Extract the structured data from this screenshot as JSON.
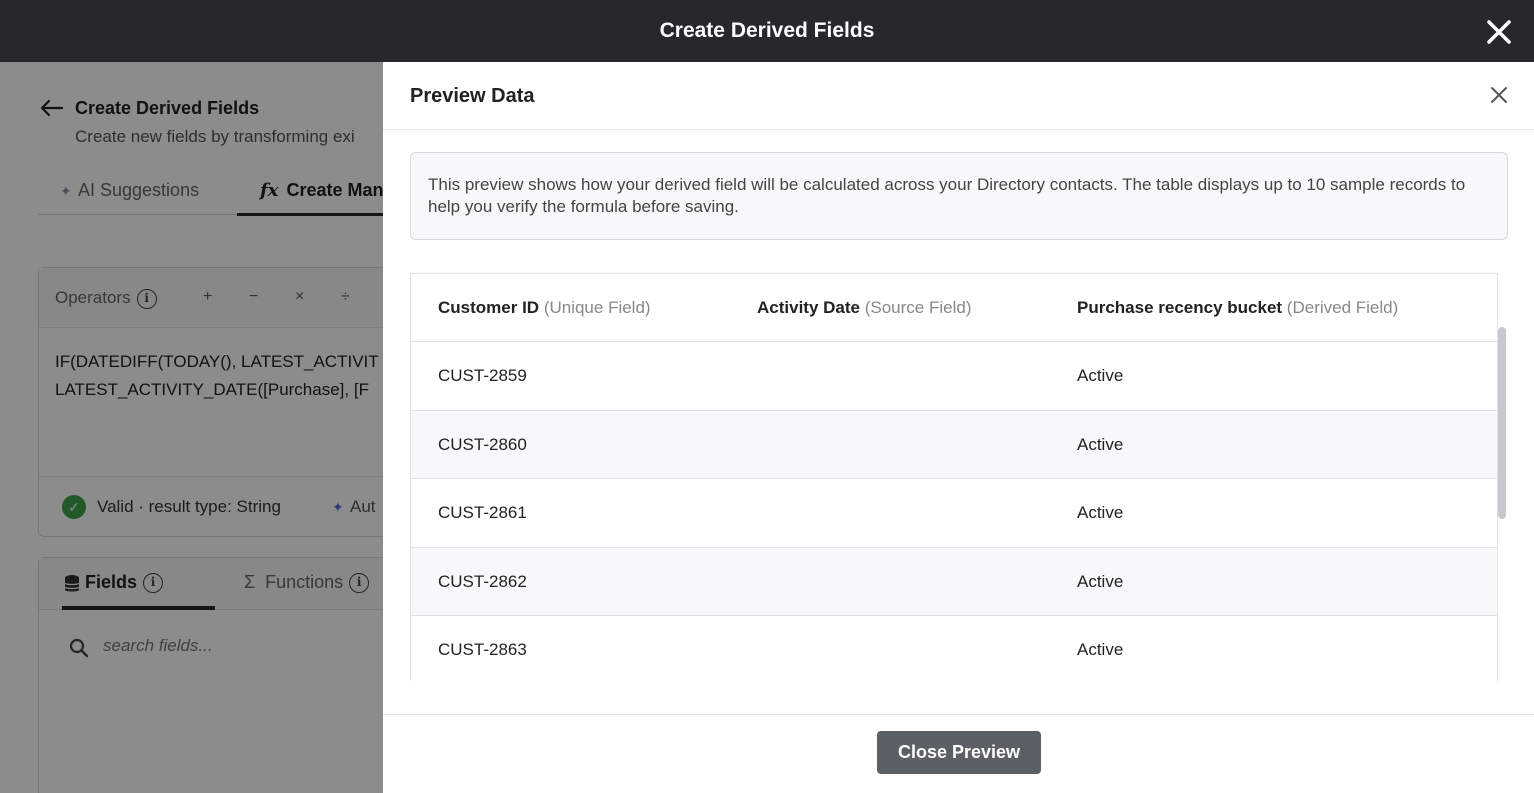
{
  "window": {
    "title": "Create Derived Fields"
  },
  "background": {
    "title": "Create Derived Fields",
    "subtitle": "Create new fields by transforming exi",
    "tabs": [
      {
        "label": "AI Suggestions"
      },
      {
        "label": "Create Man"
      }
    ],
    "operators_label": "Operators",
    "operators": [
      "+",
      "−",
      "×",
      "÷"
    ],
    "formula_lines": [
      "IF(DATEDIFF(TODAY(), LATEST_ACTIVIT",
      "LATEST_ACTIVITY_DATE([Purchase], [F"
    ],
    "validation": "Valid · result type: String",
    "auto_label": "Aut",
    "field_tabs": [
      {
        "label": "Fields"
      },
      {
        "label": "Functions"
      }
    ],
    "search_placeholder": "search fields..."
  },
  "modal": {
    "title": "Preview Data",
    "info_text": "This preview shows how your derived field will be calculated across your Directory contacts. The table displays up to 10 sample records to help you verify the formula before saving.",
    "columns": [
      {
        "name": "Customer ID",
        "hint": "(Unique Field)"
      },
      {
        "name": "Activity Date",
        "hint": "(Source Field)"
      },
      {
        "name": "Purchase recency bucket",
        "hint": "(Derived Field)"
      }
    ],
    "rows": [
      {
        "customer_id": "CUST-2859",
        "activity_date": "",
        "bucket": "Active"
      },
      {
        "customer_id": "CUST-2860",
        "activity_date": "",
        "bucket": "Active"
      },
      {
        "customer_id": "CUST-2861",
        "activity_date": "",
        "bucket": "Active"
      },
      {
        "customer_id": "CUST-2862",
        "activity_date": "",
        "bucket": "Active"
      },
      {
        "customer_id": "CUST-2863",
        "activity_date": "",
        "bucket": "Active"
      }
    ],
    "close_button": "Close Preview"
  },
  "colors": {
    "topbar": "#26282b",
    "valid_green": "#3fa34d",
    "primary_button": "#5b5f66"
  }
}
